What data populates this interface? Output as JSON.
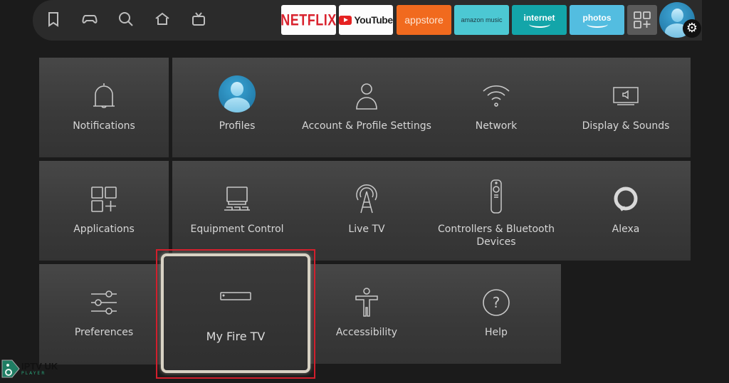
{
  "top_nav": {
    "icons": [
      "bookmark-icon",
      "gamepad-icon",
      "search-icon",
      "home-icon",
      "live-tv-icon"
    ],
    "apps": [
      {
        "name": "netflix",
        "label": "NETFLIX"
      },
      {
        "name": "youtube",
        "label": "YouTube"
      },
      {
        "name": "appstore",
        "label": "appstore"
      },
      {
        "name": "amazon-music",
        "label": "amazon music"
      },
      {
        "name": "internet",
        "label": "internet"
      },
      {
        "name": "photos",
        "label": "photos"
      }
    ],
    "more_apps_icon": "apps-grid-plus-icon",
    "profile_icon": "profile-avatar",
    "settings_icon": "gear-icon",
    "settings_glyph": "⚙"
  },
  "settings": {
    "tiles": [
      {
        "label": "Notifications",
        "icon": "bell-icon"
      },
      {
        "label": "Profiles",
        "icon": "profile-avatar-icon"
      },
      {
        "label": "Account & Profile Settings",
        "icon": "person-icon"
      },
      {
        "label": "Network",
        "icon": "wifi-icon"
      },
      {
        "label": "Display & Sounds",
        "icon": "display-sound-icon"
      },
      {
        "label": "Applications",
        "icon": "apps-icon"
      },
      {
        "label": "Equipment Control",
        "icon": "equipment-icon"
      },
      {
        "label": "Live TV",
        "icon": "antenna-icon"
      },
      {
        "label": "Controllers & Bluetooth Devices",
        "icon": "remote-icon"
      },
      {
        "label": "Alexa",
        "icon": "alexa-icon"
      },
      {
        "label": "Preferences",
        "icon": "sliders-icon"
      },
      {
        "label": "My Fire TV",
        "icon": "fire-tv-device-icon"
      },
      {
        "label": "Accessibility",
        "icon": "accessibility-icon"
      },
      {
        "label": "Help",
        "icon": "help-icon"
      }
    ],
    "focused": "My Fire TV"
  },
  "colors": {
    "background": "#1b1b1b",
    "highlight_red": "#d21f2c",
    "focus_border": "#d8d2c4",
    "netflix_red": "#d9232e",
    "appstore_orange": "#f16a1e"
  },
  "watermark": {
    "title": "IPTV UK",
    "subtitle": "PLAYER"
  }
}
